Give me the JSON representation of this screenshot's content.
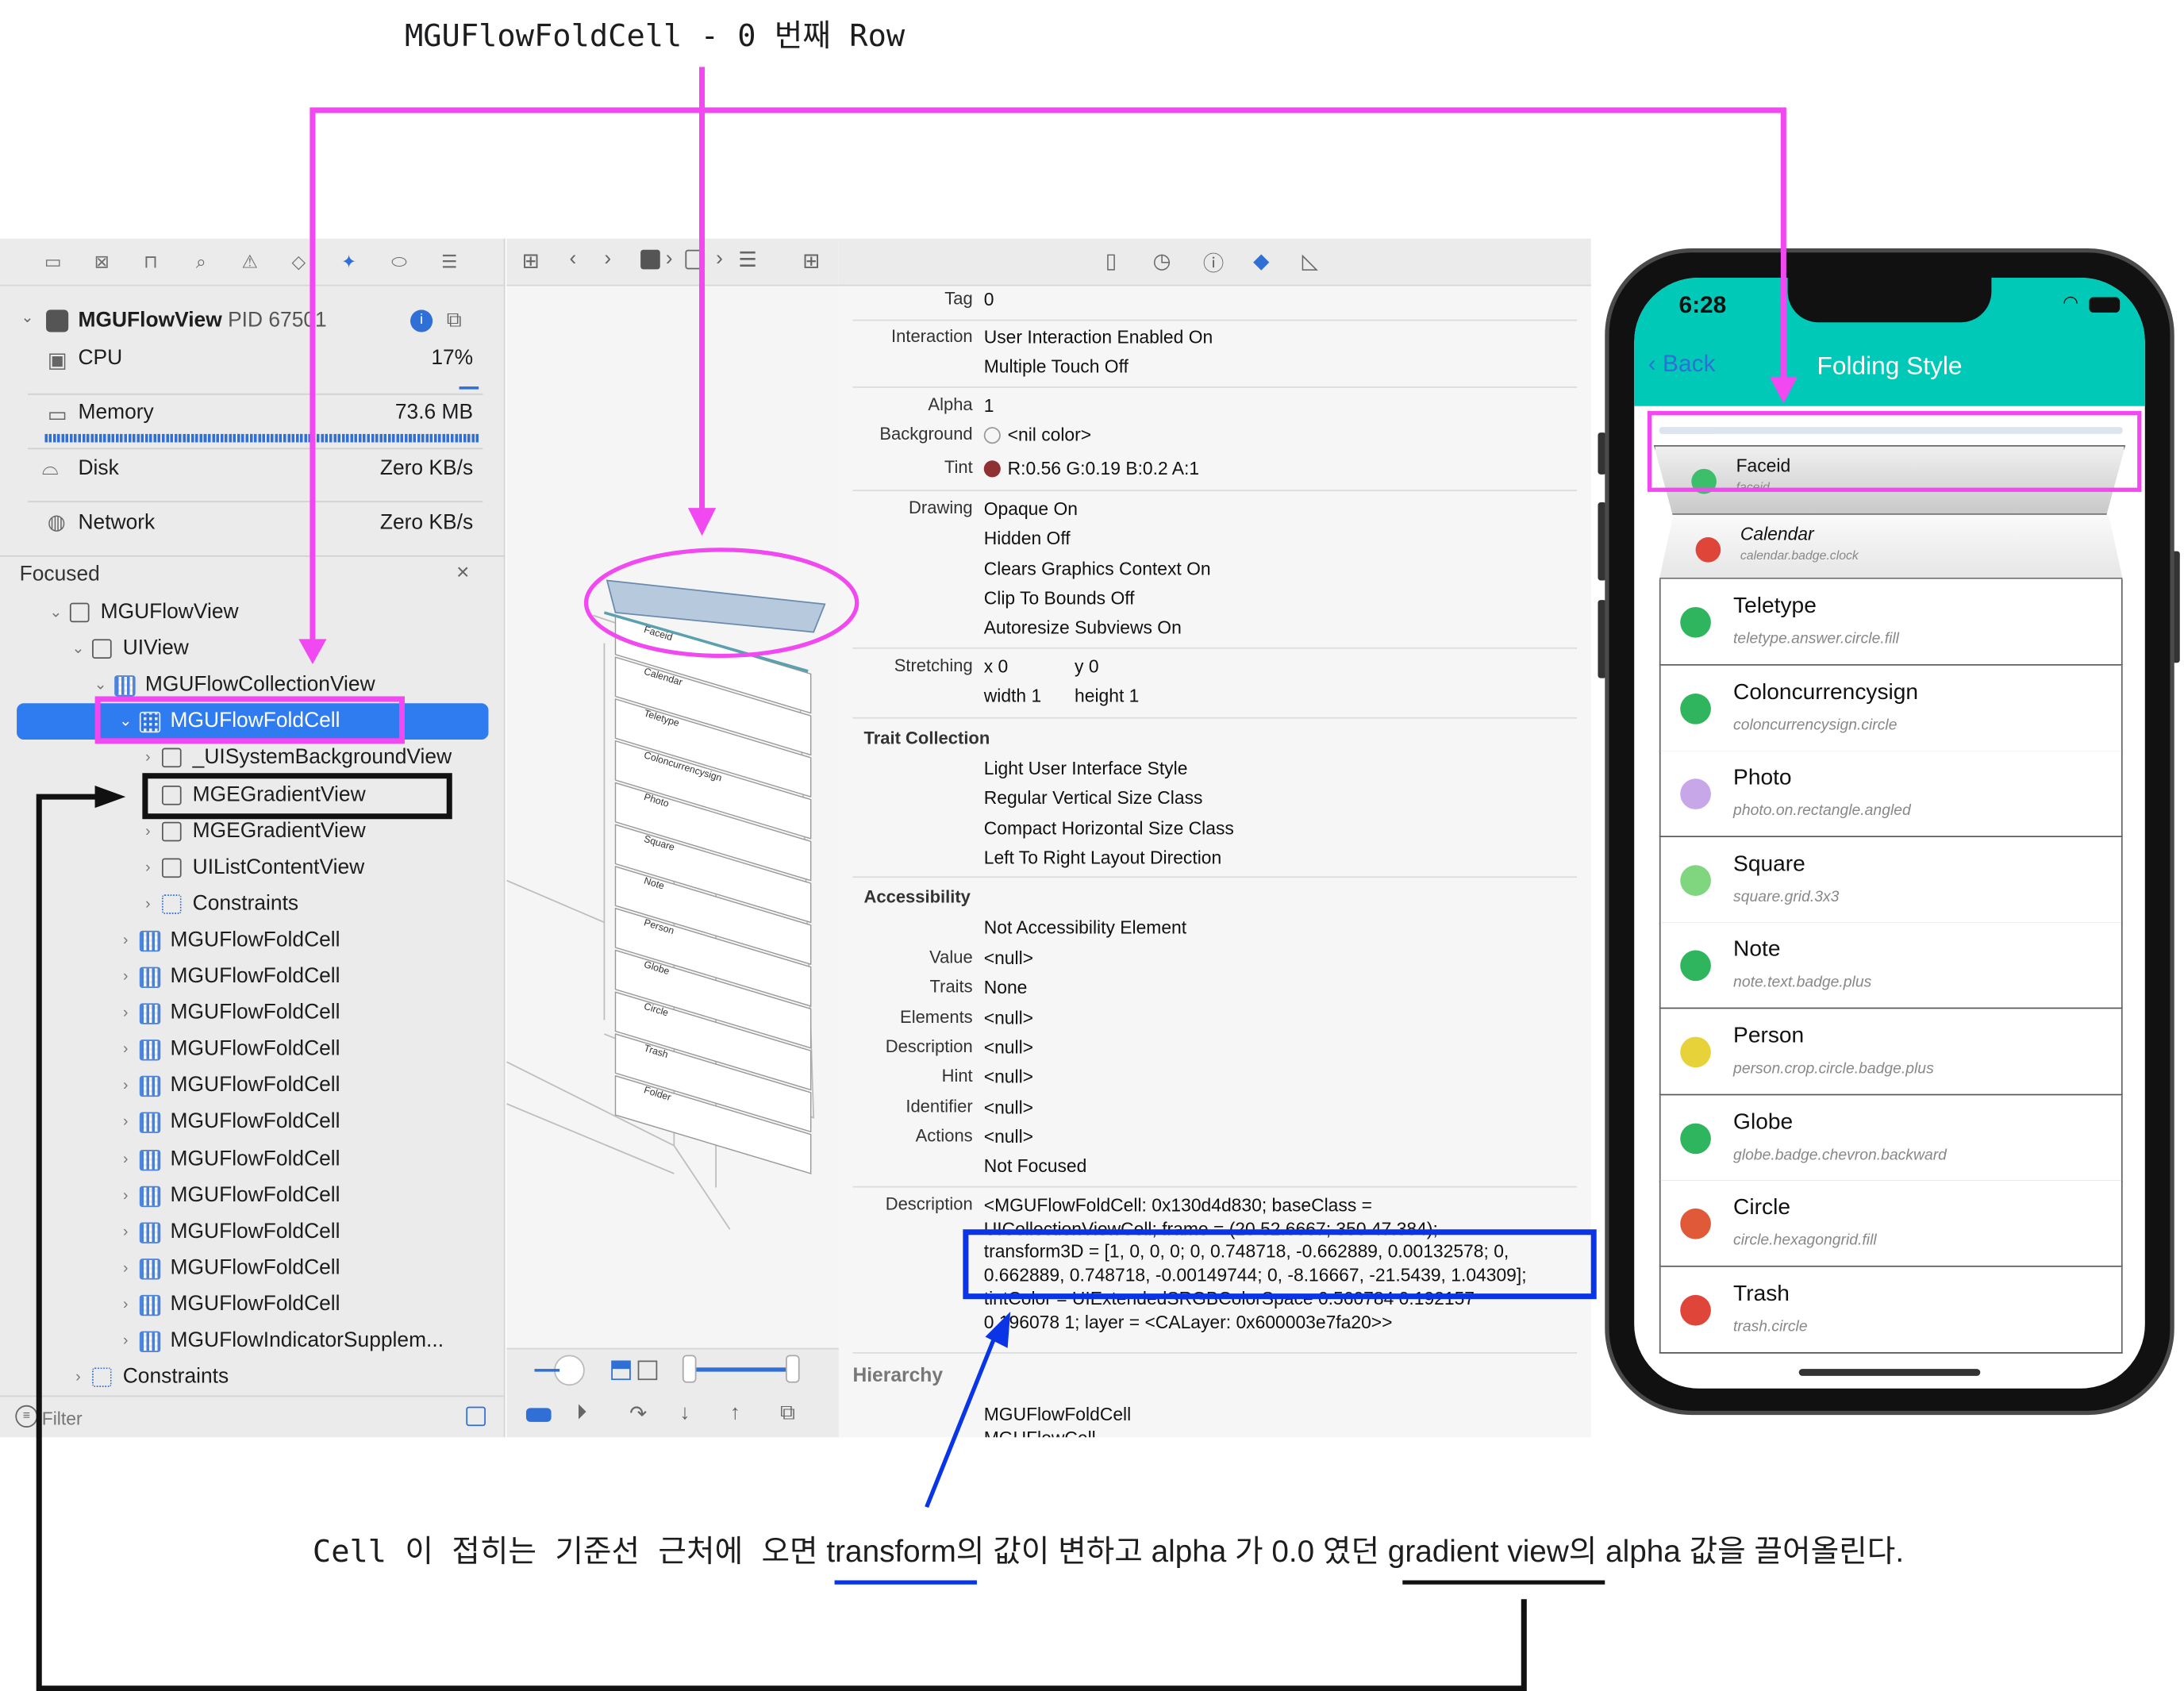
{
  "annotations": {
    "top_title": "MGUFlowFoldCell - 0 번째 Row",
    "bottom_prefix": "Cell 이 접히는 기준선 근처에 오면",
    "bottom_rest": "transform의 값이 변하고 alpha 가 0.0 였던 gradient view의 alpha 값을 끌어올린다."
  },
  "debug": {
    "process": "MGUFlowView",
    "pid": "PID 67501",
    "cpu_label": "CPU",
    "cpu_value": "17%",
    "memory_label": "Memory",
    "memory_value": "73.6 MB",
    "disk_label": "Disk",
    "disk_value": "Zero KB/s",
    "network_label": "Network",
    "network_value": "Zero KB/s",
    "focused": "Focused"
  },
  "tree": [
    "MGUFlowView",
    "UIView",
    "MGUFlowCollectionView",
    "MGUFlowFoldCell",
    "_UISystemBackgroundView",
    "MGEGradientView",
    "MGEGradientView",
    "UIListContentView",
    "Constraints",
    "MGUFlowFoldCell",
    "MGUFlowFoldCell",
    "MGUFlowFoldCell",
    "MGUFlowFoldCell",
    "MGUFlowFoldCell",
    "MGUFlowFoldCell",
    "MGUFlowFoldCell",
    "MGUFlowFoldCell",
    "MGUFlowFoldCell",
    "MGUFlowFoldCell",
    "MGUFlowFoldCell",
    "MGUFlowIndicatorSupplem...",
    "Constraints"
  ],
  "filter_placeholder": "Filter",
  "inspector": {
    "tag_k": "Tag",
    "tag_v": "0",
    "interaction_k": "Interaction",
    "interaction_v1": "User Interaction Enabled On",
    "interaction_v2": "Multiple Touch Off",
    "alpha_k": "Alpha",
    "alpha_v": "1",
    "background_k": "Background",
    "background_v": "<nil color>",
    "tint_k": "Tint",
    "tint_v": "R:0.56 G:0.19 B:0.2 A:1",
    "drawing_k": "Drawing",
    "drawing": [
      "Opaque On",
      "Hidden Off",
      "Clears Graphics Context On",
      "Clip To Bounds Off",
      "Autoresize Subviews On"
    ],
    "stretching_k": "Stretching",
    "stretch_x": "x 0",
    "stretch_y": "y 0",
    "stretch_w": "width 1",
    "stretch_h": "height 1",
    "trait_title": "Trait Collection",
    "traits": [
      "Light User Interface Style",
      "Regular Vertical Size Class",
      "Compact Horizontal Size Class",
      "Left To Right Layout Direction"
    ],
    "acc_title": "Accessibility",
    "acc_element": "Not Accessibility Element",
    "acc_rows": [
      [
        "Value",
        "<null>"
      ],
      [
        "Traits",
        "None"
      ],
      [
        "Elements",
        "<null>"
      ],
      [
        "Description",
        "<null>"
      ],
      [
        "Hint",
        "<null>"
      ],
      [
        "Identifier",
        "<null>"
      ],
      [
        "Actions",
        "<null>"
      ]
    ],
    "not_focused": "Not Focused",
    "desc_k": "Description",
    "desc_lines": [
      "<MGUFlowFoldCell: 0x130d4d830; baseClass =",
      "UICollectionViewCell; frame = (20 52.6667; 350 47.384);",
      "transform3D = [1, 0, 0, 0; 0, 0.748718, -0.662889, 0.00132578; 0,",
      "0.662889, 0.748718, -0.00149744; 0, -8.16667, -21.5439, 1.04309];",
      "tintColor = UIExtendedSRGBColorSpace 0.560784 0.192157",
      "0.196078 1; layer = <CALayer: 0x600003e7fa20>>"
    ],
    "hier_title": "Hierarchy",
    "hier_1": "MGUFlowFoldCell",
    "hier_2": "MGUFlowCell"
  },
  "phone": {
    "time": "6:28",
    "back": "Back",
    "title": "Folding Style",
    "accent": "#00c9b7",
    "rows": [
      {
        "t": "Faceid",
        "s": "faceid",
        "c": "#3cbf6a"
      },
      {
        "t": "Calendar",
        "s": "calendar.badge.clock",
        "c": "#e0453a"
      },
      {
        "t": "Teletype",
        "s": "teletype.answer.circle.fill",
        "c": "#2fb55d"
      },
      {
        "t": "Coloncurrencysign",
        "s": "coloncurrencysign.circle",
        "c": "#2fb55d"
      },
      {
        "t": "Photo",
        "s": "photo.on.rectangle.angled",
        "c": "#c7a7e8"
      },
      {
        "t": "Square",
        "s": "square.grid.3x3",
        "c": "#7fd67f"
      },
      {
        "t": "Note",
        "s": "note.text.badge.plus",
        "c": "#2fb55d"
      },
      {
        "t": "Person",
        "s": "person.crop.circle.badge.plus",
        "c": "#e8d23a"
      },
      {
        "t": "Globe",
        "s": "globe.badge.chevron.backward",
        "c": "#2fb55d"
      },
      {
        "t": "Circle",
        "s": "circle.hexagongrid.fill",
        "c": "#e05a3a"
      },
      {
        "t": "Trash",
        "s": "trash.circle",
        "c": "#e0453a"
      }
    ]
  },
  "canvas_labels": [
    "Faceid",
    "Calendar",
    "Teletype",
    "Coloncurrencysign",
    "Photo",
    "Square",
    "Note",
    "Person",
    "Globe",
    "Circle",
    "Trash",
    "Folder"
  ]
}
